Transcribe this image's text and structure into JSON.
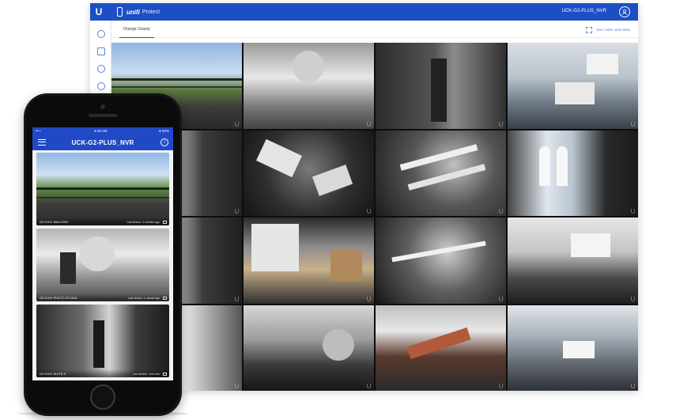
{
  "desktop": {
    "logo": "U",
    "brand": "unifi",
    "app_name": "Protect",
    "host": "UCK-G2-PLUS_NVR",
    "user_icon": "user-icon",
    "tab": "Orange County",
    "edit_view": "EDIT VIEW",
    "add_view": "ADD VIEW",
    "sidebar_icons": [
      "settings-icon",
      "camera-icon",
      "play-icon",
      "search-icon"
    ]
  },
  "phone": {
    "status": {
      "carrier": "•• ≈",
      "time": "9:16 AM",
      "battery": "● 92%"
    },
    "title": "UCK-G2-PLUS_NVR",
    "info": "i",
    "cameras": [
      {
        "name": "G3 FLEX BALCONY",
        "motion": "Last Motion: 2 minutes ago"
      },
      {
        "name": "G3 FLEX PHOTO STUDIO",
        "motion": "Last Motion: 1 minute ago"
      },
      {
        "name": "G3 FLEX SUITE 8",
        "motion": "Last Motion: Just now"
      }
    ]
  },
  "colors": {
    "brand_blue": "#1c4fc4",
    "phone_header": "#2049c6"
  }
}
